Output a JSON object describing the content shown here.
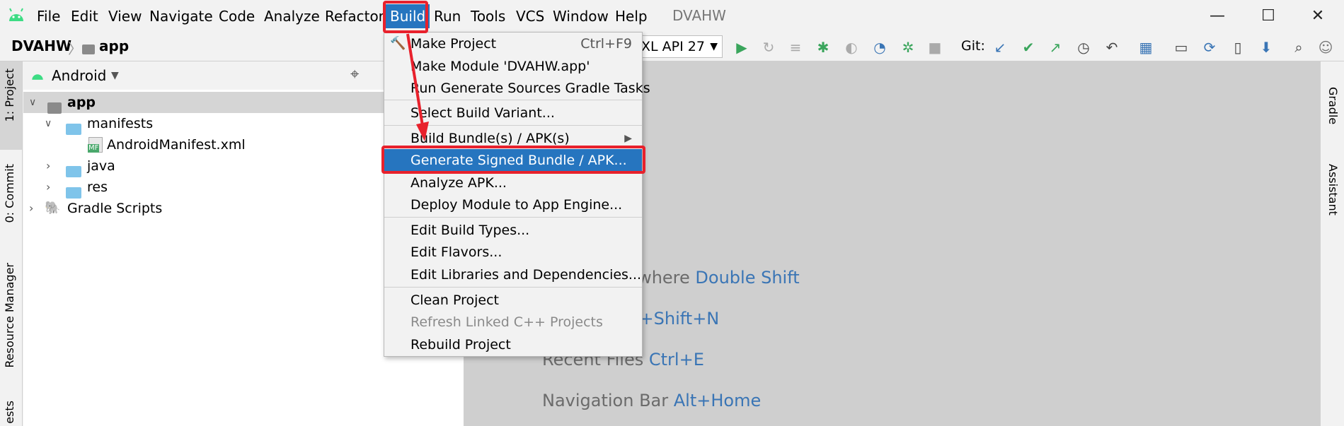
{
  "menubar": {
    "items": [
      "File",
      "Edit",
      "View",
      "Navigate",
      "Code",
      "Analyze",
      "Refactor",
      "Build",
      "Run",
      "Tools",
      "VCS",
      "Window",
      "Help"
    ],
    "window_title": "DVAHW",
    "minimize": "—",
    "maximize": "☐",
    "close": "✕"
  },
  "breadcrumb": {
    "project": "DVAHW",
    "module": "app"
  },
  "toolbar": {
    "run_config": "XL API 27",
    "git_label": "Git:"
  },
  "left_tabs": {
    "project": "1: Project",
    "commit": "0: Commit",
    "resource_manager": "Resource Manager",
    "tests": "ests"
  },
  "right_tabs": {
    "gradle": "Gradle",
    "assistant": "Assistant"
  },
  "project_panel": {
    "view_mode": "Android",
    "tree": [
      {
        "label": "app",
        "type": "module",
        "bold": true
      },
      {
        "label": "manifests",
        "type": "folder"
      },
      {
        "label": "AndroidManifest.xml",
        "type": "file",
        "badge": "MF"
      },
      {
        "label": "java",
        "type": "folder"
      },
      {
        "label": "res",
        "type": "folder"
      },
      {
        "label": "Gradle Scripts",
        "type": "gradle"
      }
    ]
  },
  "build_menu": {
    "items": [
      {
        "label": "Make Project",
        "shortcut": "Ctrl+F9"
      },
      {
        "label": "Make Module 'DVAHW.app'"
      },
      {
        "label": "Run Generate Sources Gradle Tasks"
      },
      {
        "label": "Select Build Variant..."
      },
      {
        "label": "Build Bundle(s) / APK(s)"
      },
      {
        "label": "Generate Signed Bundle / APK..."
      },
      {
        "label": "Analyze APK..."
      },
      {
        "label": "Deploy Module to App Engine..."
      },
      {
        "label": "Edit Build Types..."
      },
      {
        "label": "Edit Flavors..."
      },
      {
        "label": "Edit Libraries and Dependencies..."
      },
      {
        "label": "Clean Project"
      },
      {
        "label": "Refresh Linked C++ Projects"
      },
      {
        "label": "Rebuild Project"
      }
    ]
  },
  "editor_hints": [
    {
      "text": "rywhere ",
      "key": "Double Shift"
    },
    {
      "text": "",
      "key": "rl+Shift+N"
    },
    {
      "text": "Recent Files ",
      "key": "Ctrl+E"
    },
    {
      "text": "Navigation Bar ",
      "key": "Alt+Home"
    }
  ],
  "colors": {
    "highlight": "#2675bf",
    "annotation_red": "#e8212c",
    "hint_key": "#3a75b5"
  }
}
